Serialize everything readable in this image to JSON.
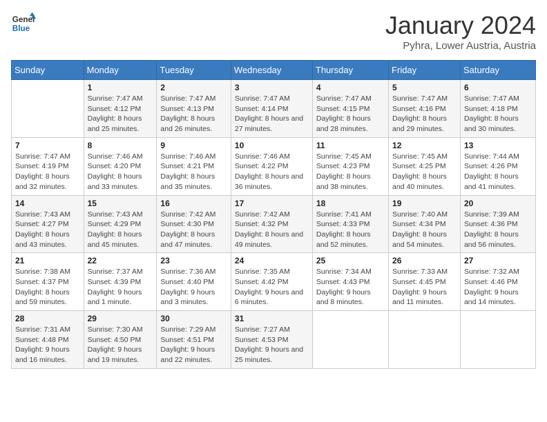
{
  "logo": {
    "line1": "General",
    "line2": "Blue"
  },
  "title": "January 2024",
  "location": "Pyhra, Lower Austria, Austria",
  "days_of_week": [
    "Sunday",
    "Monday",
    "Tuesday",
    "Wednesday",
    "Thursday",
    "Friday",
    "Saturday"
  ],
  "weeks": [
    [
      {
        "day": "",
        "sunrise": "",
        "sunset": "",
        "daylight": ""
      },
      {
        "day": "1",
        "sunrise": "Sunrise: 7:47 AM",
        "sunset": "Sunset: 4:12 PM",
        "daylight": "Daylight: 8 hours and 25 minutes."
      },
      {
        "day": "2",
        "sunrise": "Sunrise: 7:47 AM",
        "sunset": "Sunset: 4:13 PM",
        "daylight": "Daylight: 8 hours and 26 minutes."
      },
      {
        "day": "3",
        "sunrise": "Sunrise: 7:47 AM",
        "sunset": "Sunset: 4:14 PM",
        "daylight": "Daylight: 8 hours and 27 minutes."
      },
      {
        "day": "4",
        "sunrise": "Sunrise: 7:47 AM",
        "sunset": "Sunset: 4:15 PM",
        "daylight": "Daylight: 8 hours and 28 minutes."
      },
      {
        "day": "5",
        "sunrise": "Sunrise: 7:47 AM",
        "sunset": "Sunset: 4:16 PM",
        "daylight": "Daylight: 8 hours and 29 minutes."
      },
      {
        "day": "6",
        "sunrise": "Sunrise: 7:47 AM",
        "sunset": "Sunset: 4:18 PM",
        "daylight": "Daylight: 8 hours and 30 minutes."
      }
    ],
    [
      {
        "day": "7",
        "sunrise": "Sunrise: 7:47 AM",
        "sunset": "Sunset: 4:19 PM",
        "daylight": "Daylight: 8 hours and 32 minutes."
      },
      {
        "day": "8",
        "sunrise": "Sunrise: 7:46 AM",
        "sunset": "Sunset: 4:20 PM",
        "daylight": "Daylight: 8 hours and 33 minutes."
      },
      {
        "day": "9",
        "sunrise": "Sunrise: 7:46 AM",
        "sunset": "Sunset: 4:21 PM",
        "daylight": "Daylight: 8 hours and 35 minutes."
      },
      {
        "day": "10",
        "sunrise": "Sunrise: 7:46 AM",
        "sunset": "Sunset: 4:22 PM",
        "daylight": "Daylight: 8 hours and 36 minutes."
      },
      {
        "day": "11",
        "sunrise": "Sunrise: 7:45 AM",
        "sunset": "Sunset: 4:23 PM",
        "daylight": "Daylight: 8 hours and 38 minutes."
      },
      {
        "day": "12",
        "sunrise": "Sunrise: 7:45 AM",
        "sunset": "Sunset: 4:25 PM",
        "daylight": "Daylight: 8 hours and 40 minutes."
      },
      {
        "day": "13",
        "sunrise": "Sunrise: 7:44 AM",
        "sunset": "Sunset: 4:26 PM",
        "daylight": "Daylight: 8 hours and 41 minutes."
      }
    ],
    [
      {
        "day": "14",
        "sunrise": "Sunrise: 7:43 AM",
        "sunset": "Sunset: 4:27 PM",
        "daylight": "Daylight: 8 hours and 43 minutes."
      },
      {
        "day": "15",
        "sunrise": "Sunrise: 7:43 AM",
        "sunset": "Sunset: 4:29 PM",
        "daylight": "Daylight: 8 hours and 45 minutes."
      },
      {
        "day": "16",
        "sunrise": "Sunrise: 7:42 AM",
        "sunset": "Sunset: 4:30 PM",
        "daylight": "Daylight: 8 hours and 47 minutes."
      },
      {
        "day": "17",
        "sunrise": "Sunrise: 7:42 AM",
        "sunset": "Sunset: 4:32 PM",
        "daylight": "Daylight: 8 hours and 49 minutes."
      },
      {
        "day": "18",
        "sunrise": "Sunrise: 7:41 AM",
        "sunset": "Sunset: 4:33 PM",
        "daylight": "Daylight: 8 hours and 52 minutes."
      },
      {
        "day": "19",
        "sunrise": "Sunrise: 7:40 AM",
        "sunset": "Sunset: 4:34 PM",
        "daylight": "Daylight: 8 hours and 54 minutes."
      },
      {
        "day": "20",
        "sunrise": "Sunrise: 7:39 AM",
        "sunset": "Sunset: 4:36 PM",
        "daylight": "Daylight: 8 hours and 56 minutes."
      }
    ],
    [
      {
        "day": "21",
        "sunrise": "Sunrise: 7:38 AM",
        "sunset": "Sunset: 4:37 PM",
        "daylight": "Daylight: 8 hours and 59 minutes."
      },
      {
        "day": "22",
        "sunrise": "Sunrise: 7:37 AM",
        "sunset": "Sunset: 4:39 PM",
        "daylight": "Daylight: 9 hours and 1 minute."
      },
      {
        "day": "23",
        "sunrise": "Sunrise: 7:36 AM",
        "sunset": "Sunset: 4:40 PM",
        "daylight": "Daylight: 9 hours and 3 minutes."
      },
      {
        "day": "24",
        "sunrise": "Sunrise: 7:35 AM",
        "sunset": "Sunset: 4:42 PM",
        "daylight": "Daylight: 9 hours and 6 minutes."
      },
      {
        "day": "25",
        "sunrise": "Sunrise: 7:34 AM",
        "sunset": "Sunset: 4:43 PM",
        "daylight": "Daylight: 9 hours and 8 minutes."
      },
      {
        "day": "26",
        "sunrise": "Sunrise: 7:33 AM",
        "sunset": "Sunset: 4:45 PM",
        "daylight": "Daylight: 9 hours and 11 minutes."
      },
      {
        "day": "27",
        "sunrise": "Sunrise: 7:32 AM",
        "sunset": "Sunset: 4:46 PM",
        "daylight": "Daylight: 9 hours and 14 minutes."
      }
    ],
    [
      {
        "day": "28",
        "sunrise": "Sunrise: 7:31 AM",
        "sunset": "Sunset: 4:48 PM",
        "daylight": "Daylight: 9 hours and 16 minutes."
      },
      {
        "day": "29",
        "sunrise": "Sunrise: 7:30 AM",
        "sunset": "Sunset: 4:50 PM",
        "daylight": "Daylight: 9 hours and 19 minutes."
      },
      {
        "day": "30",
        "sunrise": "Sunrise: 7:29 AM",
        "sunset": "Sunset: 4:51 PM",
        "daylight": "Daylight: 9 hours and 22 minutes."
      },
      {
        "day": "31",
        "sunrise": "Sunrise: 7:27 AM",
        "sunset": "Sunset: 4:53 PM",
        "daylight": "Daylight: 9 hours and 25 minutes."
      },
      {
        "day": "",
        "sunrise": "",
        "sunset": "",
        "daylight": ""
      },
      {
        "day": "",
        "sunrise": "",
        "sunset": "",
        "daylight": ""
      },
      {
        "day": "",
        "sunrise": "",
        "sunset": "",
        "daylight": ""
      }
    ]
  ]
}
